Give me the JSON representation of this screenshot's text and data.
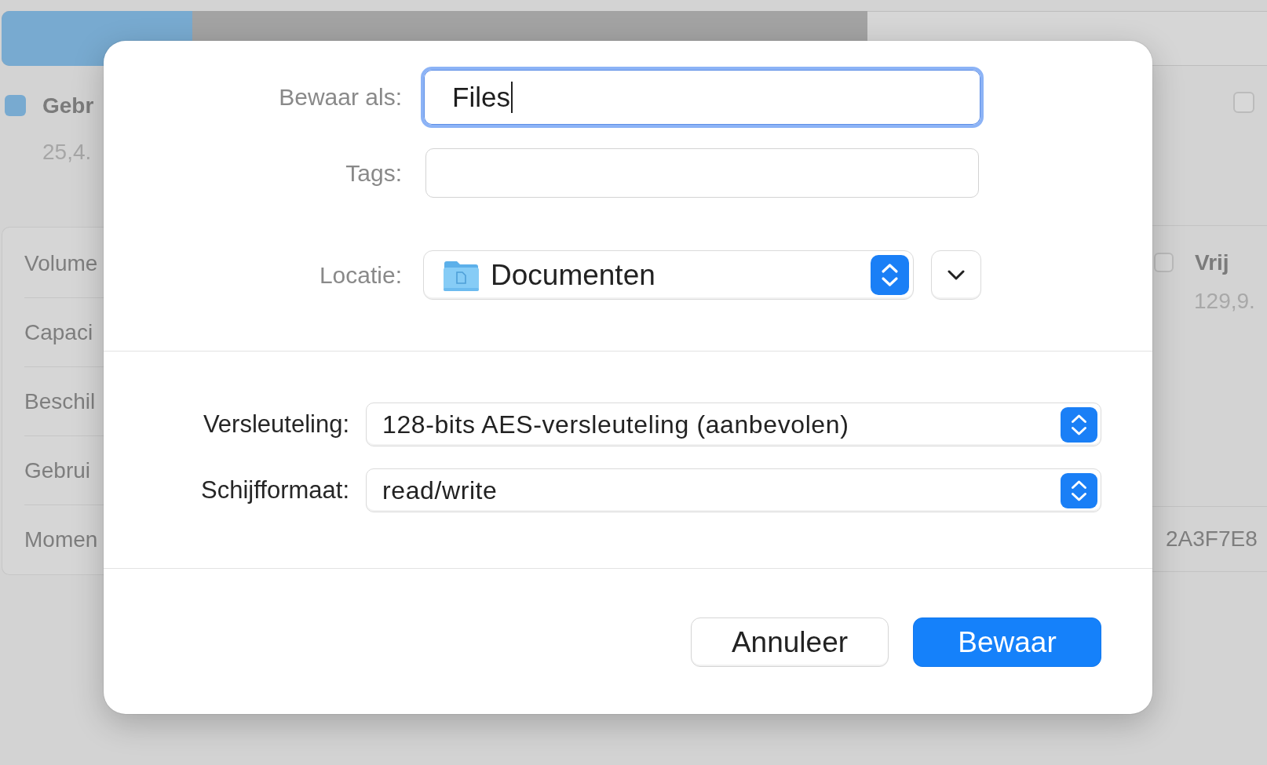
{
  "background": {
    "usage_bar": {
      "level": 0.22
    },
    "legend": [
      {
        "kind": "filled",
        "color": "#78aad0",
        "label": "Gebr",
        "value": "25,4."
      },
      {
        "kind": "outline",
        "label": "Vrij",
        "value": "129,9."
      }
    ],
    "corner_swatch": {
      "kind": "outline"
    },
    "info_rows": [
      {
        "label": "Volume"
      },
      {
        "label": "Capaci"
      },
      {
        "label": "Beschil"
      },
      {
        "label": "Gebrui"
      },
      {
        "label": "Momen",
        "value": "2A3F7E8"
      }
    ]
  },
  "save_sheet": {
    "fields": [
      {
        "kind": "text",
        "label": "Bewaar als:",
        "value": "Files",
        "focused": true
      },
      {
        "kind": "text",
        "label": "Tags:",
        "focused": false
      },
      {
        "kind": "location",
        "label": "Locatie:",
        "value": "Documenten",
        "expanded": false
      }
    ],
    "options": [
      {
        "label": "Versleuteling:",
        "value": "128-bits AES-versleuteling (aanbevolen)"
      },
      {
        "label": "Schijfformaat:",
        "value": "read/write"
      }
    ],
    "buttons": [
      {
        "kind": "secondary",
        "label": "Annuleer"
      },
      {
        "kind": "primary",
        "label": "Bewaar"
      }
    ]
  }
}
